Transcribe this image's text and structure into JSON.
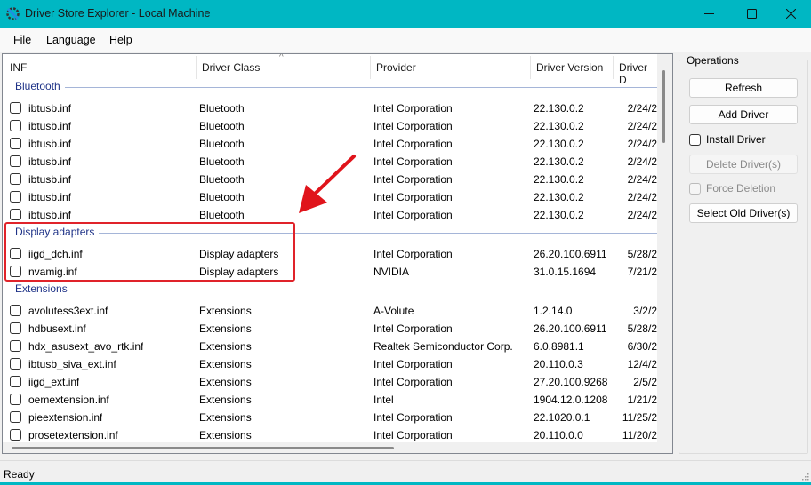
{
  "window": {
    "title": "Driver Store Explorer - Local Machine",
    "app_icon": "gear-wrench-icon",
    "controls": [
      "minimize-icon",
      "maximize-icon",
      "close-icon"
    ]
  },
  "menu": {
    "items": [
      {
        "label": "File"
      },
      {
        "label": "Language"
      },
      {
        "label": "Help"
      }
    ]
  },
  "list": {
    "columns": [
      {
        "label": "INF"
      },
      {
        "label": "Driver Class"
      },
      {
        "label": "Provider"
      },
      {
        "label": "Driver Version"
      },
      {
        "label": "Driver D"
      }
    ],
    "sort_indicator": "^",
    "groups": [
      {
        "title": "Bluetooth",
        "rows": [
          {
            "inf": "ibtusb.inf",
            "class": "Bluetooth",
            "provider": "Intel Corporation",
            "version": "22.130.0.2",
            "date": "2/24/2"
          },
          {
            "inf": "ibtusb.inf",
            "class": "Bluetooth",
            "provider": "Intel Corporation",
            "version": "22.130.0.2",
            "date": "2/24/2"
          },
          {
            "inf": "ibtusb.inf",
            "class": "Bluetooth",
            "provider": "Intel Corporation",
            "version": "22.130.0.2",
            "date": "2/24/2"
          },
          {
            "inf": "ibtusb.inf",
            "class": "Bluetooth",
            "provider": "Intel Corporation",
            "version": "22.130.0.2",
            "date": "2/24/2"
          },
          {
            "inf": "ibtusb.inf",
            "class": "Bluetooth",
            "provider": "Intel Corporation",
            "version": "22.130.0.2",
            "date": "2/24/2"
          },
          {
            "inf": "ibtusb.inf",
            "class": "Bluetooth",
            "provider": "Intel Corporation",
            "version": "22.130.0.2",
            "date": "2/24/2"
          },
          {
            "inf": "ibtusb.inf",
            "class": "Bluetooth",
            "provider": "Intel Corporation",
            "version": "22.130.0.2",
            "date": "2/24/2"
          }
        ]
      },
      {
        "title": "Display adapters",
        "rows": [
          {
            "inf": "iigd_dch.inf",
            "class": "Display adapters",
            "provider": "Intel Corporation",
            "version": "26.20.100.6911",
            "date": "5/28/2"
          },
          {
            "inf": "nvamig.inf",
            "class": "Display adapters",
            "provider": "NVIDIA",
            "version": "31.0.15.1694",
            "date": "7/21/2"
          }
        ]
      },
      {
        "title": "Extensions",
        "rows": [
          {
            "inf": "avolutess3ext.inf",
            "class": "Extensions",
            "provider": "A-Volute",
            "version": "1.2.14.0",
            "date": "3/2/2"
          },
          {
            "inf": "hdbusext.inf",
            "class": "Extensions",
            "provider": "Intel Corporation",
            "version": "26.20.100.6911",
            "date": "5/28/2"
          },
          {
            "inf": "hdx_asusext_avo_rtk.inf",
            "class": "Extensions",
            "provider": "Realtek Semiconductor Corp.",
            "version": "6.0.8981.1",
            "date": "6/30/2"
          },
          {
            "inf": "ibtusb_siva_ext.inf",
            "class": "Extensions",
            "provider": "Intel Corporation",
            "version": "20.110.0.3",
            "date": "12/4/2"
          },
          {
            "inf": "iigd_ext.inf",
            "class": "Extensions",
            "provider": "Intel Corporation",
            "version": "27.20.100.9268",
            "date": "2/5/2"
          },
          {
            "inf": "oemextension.inf",
            "class": "Extensions",
            "provider": "Intel",
            "version": "1904.12.0.1208",
            "date": "1/21/2"
          },
          {
            "inf": "pieextension.inf",
            "class": "Extensions",
            "provider": "Intel Corporation",
            "version": "22.1020.0.1",
            "date": "11/25/2"
          },
          {
            "inf": "prosetextension.inf",
            "class": "Extensions",
            "provider": "Intel Corporation",
            "version": "20.110.0.0",
            "date": "11/20/2"
          }
        ]
      }
    ]
  },
  "operations": {
    "title": "Operations",
    "refresh": "Refresh",
    "add_driver": "Add Driver",
    "install_driver": "Install Driver",
    "delete_drivers": "Delete Driver(s)",
    "force_deletion": "Force Deletion",
    "select_old": "Select Old Driver(s)"
  },
  "status": {
    "text": "Ready"
  },
  "colors": {
    "titlebar": "#00b7c3",
    "group_title": "#1e3287",
    "annotation": "#e0232a"
  }
}
